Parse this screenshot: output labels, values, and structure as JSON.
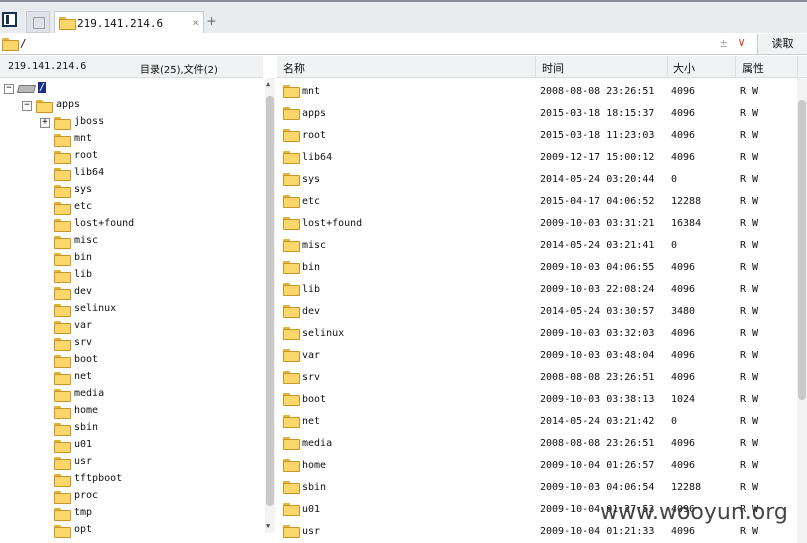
{
  "tab": {
    "title": "219.141.214.6",
    "close": "×",
    "add": "+"
  },
  "address": {
    "path": "/",
    "extra": "±",
    "dropdown": "∨",
    "read_button": "读取"
  },
  "left_panel": {
    "host": "219.141.214.6",
    "summary": "目录(25),文件(2)",
    "tree": [
      {
        "label": "/",
        "level": 0,
        "type": "drive",
        "expander": "−",
        "selected": true
      },
      {
        "label": "apps",
        "level": 1,
        "type": "folder",
        "expander": "−"
      },
      {
        "label": "jboss",
        "level": 2,
        "type": "folder",
        "expander": "+"
      },
      {
        "label": "mnt",
        "level": 1,
        "type": "folder"
      },
      {
        "label": "root",
        "level": 1,
        "type": "folder"
      },
      {
        "label": "lib64",
        "level": 1,
        "type": "folder"
      },
      {
        "label": "sys",
        "level": 1,
        "type": "folder"
      },
      {
        "label": "etc",
        "level": 1,
        "type": "folder"
      },
      {
        "label": "lost+found",
        "level": 1,
        "type": "folder"
      },
      {
        "label": "misc",
        "level": 1,
        "type": "folder"
      },
      {
        "label": "bin",
        "level": 1,
        "type": "folder"
      },
      {
        "label": "lib",
        "level": 1,
        "type": "folder"
      },
      {
        "label": "dev",
        "level": 1,
        "type": "folder"
      },
      {
        "label": "selinux",
        "level": 1,
        "type": "folder"
      },
      {
        "label": "var",
        "level": 1,
        "type": "folder"
      },
      {
        "label": "srv",
        "level": 1,
        "type": "folder"
      },
      {
        "label": "boot",
        "level": 1,
        "type": "folder"
      },
      {
        "label": "net",
        "level": 1,
        "type": "folder"
      },
      {
        "label": "media",
        "level": 1,
        "type": "folder"
      },
      {
        "label": "home",
        "level": 1,
        "type": "folder"
      },
      {
        "label": "sbin",
        "level": 1,
        "type": "folder"
      },
      {
        "label": "u01",
        "level": 1,
        "type": "folder"
      },
      {
        "label": "usr",
        "level": 1,
        "type": "folder"
      },
      {
        "label": "tftpboot",
        "level": 1,
        "type": "folder"
      },
      {
        "label": "proc",
        "level": 1,
        "type": "folder"
      },
      {
        "label": "tmp",
        "level": 1,
        "type": "folder"
      },
      {
        "label": "opt",
        "level": 1,
        "type": "folder"
      }
    ]
  },
  "file_list": {
    "columns": [
      "名称",
      "时间",
      "大小",
      "属性"
    ],
    "rows": [
      {
        "name": "mnt",
        "time": "2008-08-08 23:26:51",
        "size": "4096",
        "attr": "R W"
      },
      {
        "name": "apps",
        "time": "2015-03-18 18:15:37",
        "size": "4096",
        "attr": "R W"
      },
      {
        "name": "root",
        "time": "2015-03-18 11:23:03",
        "size": "4096",
        "attr": "R W"
      },
      {
        "name": "lib64",
        "time": "2009-12-17 15:00:12",
        "size": "4096",
        "attr": "R W"
      },
      {
        "name": "sys",
        "time": "2014-05-24 03:20:44",
        "size": "0",
        "attr": "R W"
      },
      {
        "name": "etc",
        "time": "2015-04-17 04:06:52",
        "size": "12288",
        "attr": "R W"
      },
      {
        "name": "lost+found",
        "time": "2009-10-03 03:31:21",
        "size": "16384",
        "attr": "R W"
      },
      {
        "name": "misc",
        "time": "2014-05-24 03:21:41",
        "size": "0",
        "attr": "R W"
      },
      {
        "name": "bin",
        "time": "2009-10-03 04:06:55",
        "size": "4096",
        "attr": "R W"
      },
      {
        "name": "lib",
        "time": "2009-10-03 22:08:24",
        "size": "4096",
        "attr": "R W"
      },
      {
        "name": "dev",
        "time": "2014-05-24 03:30:57",
        "size": "3480",
        "attr": "R W"
      },
      {
        "name": "selinux",
        "time": "2009-10-03 03:32:03",
        "size": "4096",
        "attr": "R W"
      },
      {
        "name": "var",
        "time": "2009-10-03 03:48:04",
        "size": "4096",
        "attr": "R W"
      },
      {
        "name": "srv",
        "time": "2008-08-08 23:26:51",
        "size": "4096",
        "attr": "R W"
      },
      {
        "name": "boot",
        "time": "2009-10-03 03:38:13",
        "size": "1024",
        "attr": "R W"
      },
      {
        "name": "net",
        "time": "2014-05-24 03:21:42",
        "size": "0",
        "attr": "R W"
      },
      {
        "name": "media",
        "time": "2008-08-08 23:26:51",
        "size": "4096",
        "attr": "R W"
      },
      {
        "name": "home",
        "time": "2009-10-04 01:26:57",
        "size": "4096",
        "attr": "R W"
      },
      {
        "name": "sbin",
        "time": "2009-10-03 04:06:54",
        "size": "12288",
        "attr": "R W"
      },
      {
        "name": "u01",
        "time": "2009-10-04 01:27:53",
        "size": "4096",
        "attr": "R W"
      },
      {
        "name": "usr",
        "time": "2009-10-04 01:21:33",
        "size": "4096",
        "attr": "R W"
      }
    ]
  },
  "watermark": "www.wooyun.org"
}
